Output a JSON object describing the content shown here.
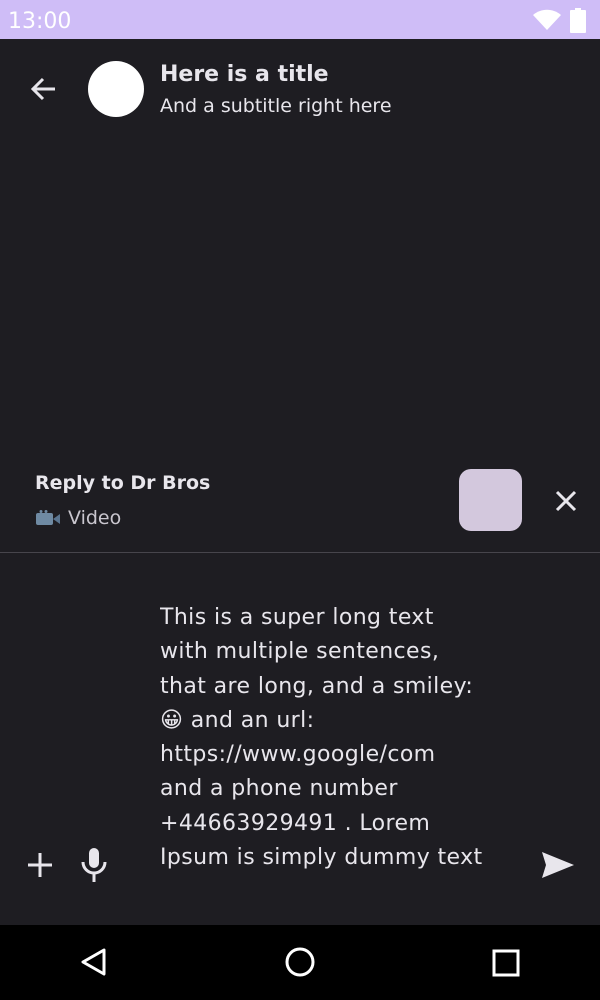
{
  "status_bar": {
    "time": "13:00",
    "icons": [
      "wifi-icon",
      "battery-icon"
    ]
  },
  "header": {
    "title": "Here is a title",
    "subtitle": "And a subtitle right here"
  },
  "reply": {
    "title": "Reply to Dr Bros",
    "media_label": "Video",
    "media_icon": "video-camera-icon"
  },
  "composer": {
    "message": "This is a super long text\nwith multiple sentences,\nthat are long, and a smiley:\n😀 and an url:\nhttps://www.google/com\nand a phone number\n+44663929491 . Lorem\nIpsum is simply dummy text"
  },
  "colors": {
    "status_bar": "#cfbdf7",
    "background": "#1e1d22",
    "reply_thumbnail": "#d3c8dd",
    "text": "#e8e6ec"
  }
}
